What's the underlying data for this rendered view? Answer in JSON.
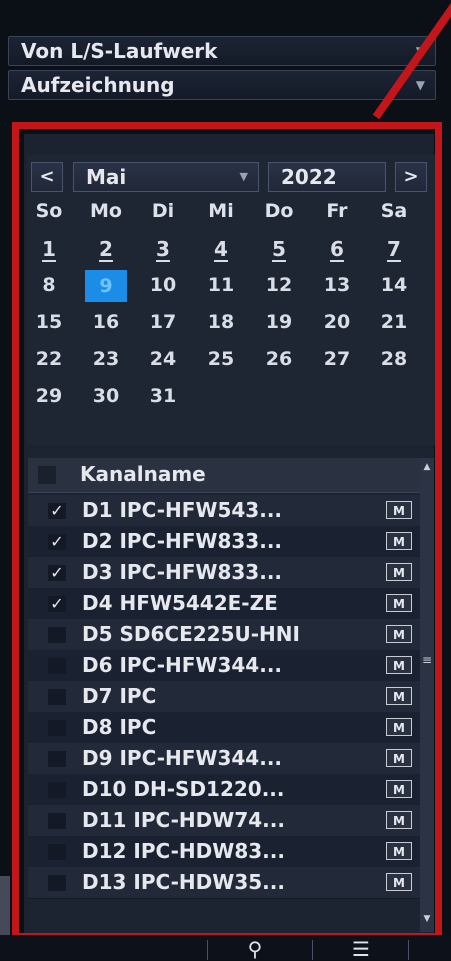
{
  "source_dropdown": {
    "value": "Von L/S-Laufwerk"
  },
  "type_dropdown": {
    "value": "Aufzeichnung"
  },
  "calendar": {
    "prev": "<",
    "next": ">",
    "month": "Mai",
    "year": "2022",
    "weekdays": [
      "So",
      "Mo",
      "Di",
      "Mi",
      "Do",
      "Fr",
      "Sa"
    ],
    "weeks": [
      [
        "1",
        "2",
        "3",
        "4",
        "5",
        "6",
        "7"
      ],
      [
        "8",
        "9",
        "10",
        "11",
        "12",
        "13",
        "14"
      ],
      [
        "15",
        "16",
        "17",
        "18",
        "19",
        "20",
        "21"
      ],
      [
        "22",
        "23",
        "24",
        "25",
        "26",
        "27",
        "28"
      ],
      [
        "29",
        "30",
        "31",
        "",
        "",
        "",
        ""
      ]
    ],
    "selected_day": "9",
    "colors": {
      "selected": "#1c8de6"
    }
  },
  "channel_list": {
    "header": "Kanalname",
    "badge_label": "M",
    "channels": [
      {
        "name": "D1 IPC-HFW543...",
        "checked": true
      },
      {
        "name": "D2 IPC-HFW833...",
        "checked": true
      },
      {
        "name": "D3 IPC-HFW833...",
        "checked": true
      },
      {
        "name": "D4 HFW5442E-ZE",
        "checked": true
      },
      {
        "name": "D5 SD6CE225U-HNI",
        "checked": false
      },
      {
        "name": "D6 IPC-HFW344...",
        "checked": false
      },
      {
        "name": "D7 IPC",
        "checked": false
      },
      {
        "name": "D8 IPC",
        "checked": false
      },
      {
        "name": "D9 IPC-HFW344...",
        "checked": false
      },
      {
        "name": "D10 DH-SD1220...",
        "checked": false
      },
      {
        "name": "D11 IPC-HDW74...",
        "checked": false
      },
      {
        "name": "D12 IPC-HDW83...",
        "checked": false
      },
      {
        "name": "D13 IPC-HDW35...",
        "checked": false
      }
    ]
  },
  "toolbar": {
    "icons": [
      "search-camera-icon",
      "list-icon"
    ]
  },
  "accent": {
    "highlight": "#c2161b"
  }
}
